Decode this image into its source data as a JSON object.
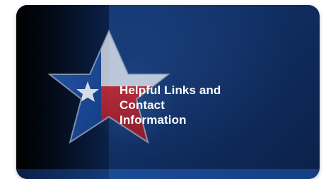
{
  "card": {
    "title_lines": [
      "Helpful Links and",
      "Contact",
      "Information"
    ]
  },
  "colors": {
    "background": "#123770",
    "star_red": "#b1232f",
    "star_blue": "#1f4fa6",
    "text": "#ffffff"
  },
  "icons": {
    "emblem": "texas-star-icon"
  }
}
